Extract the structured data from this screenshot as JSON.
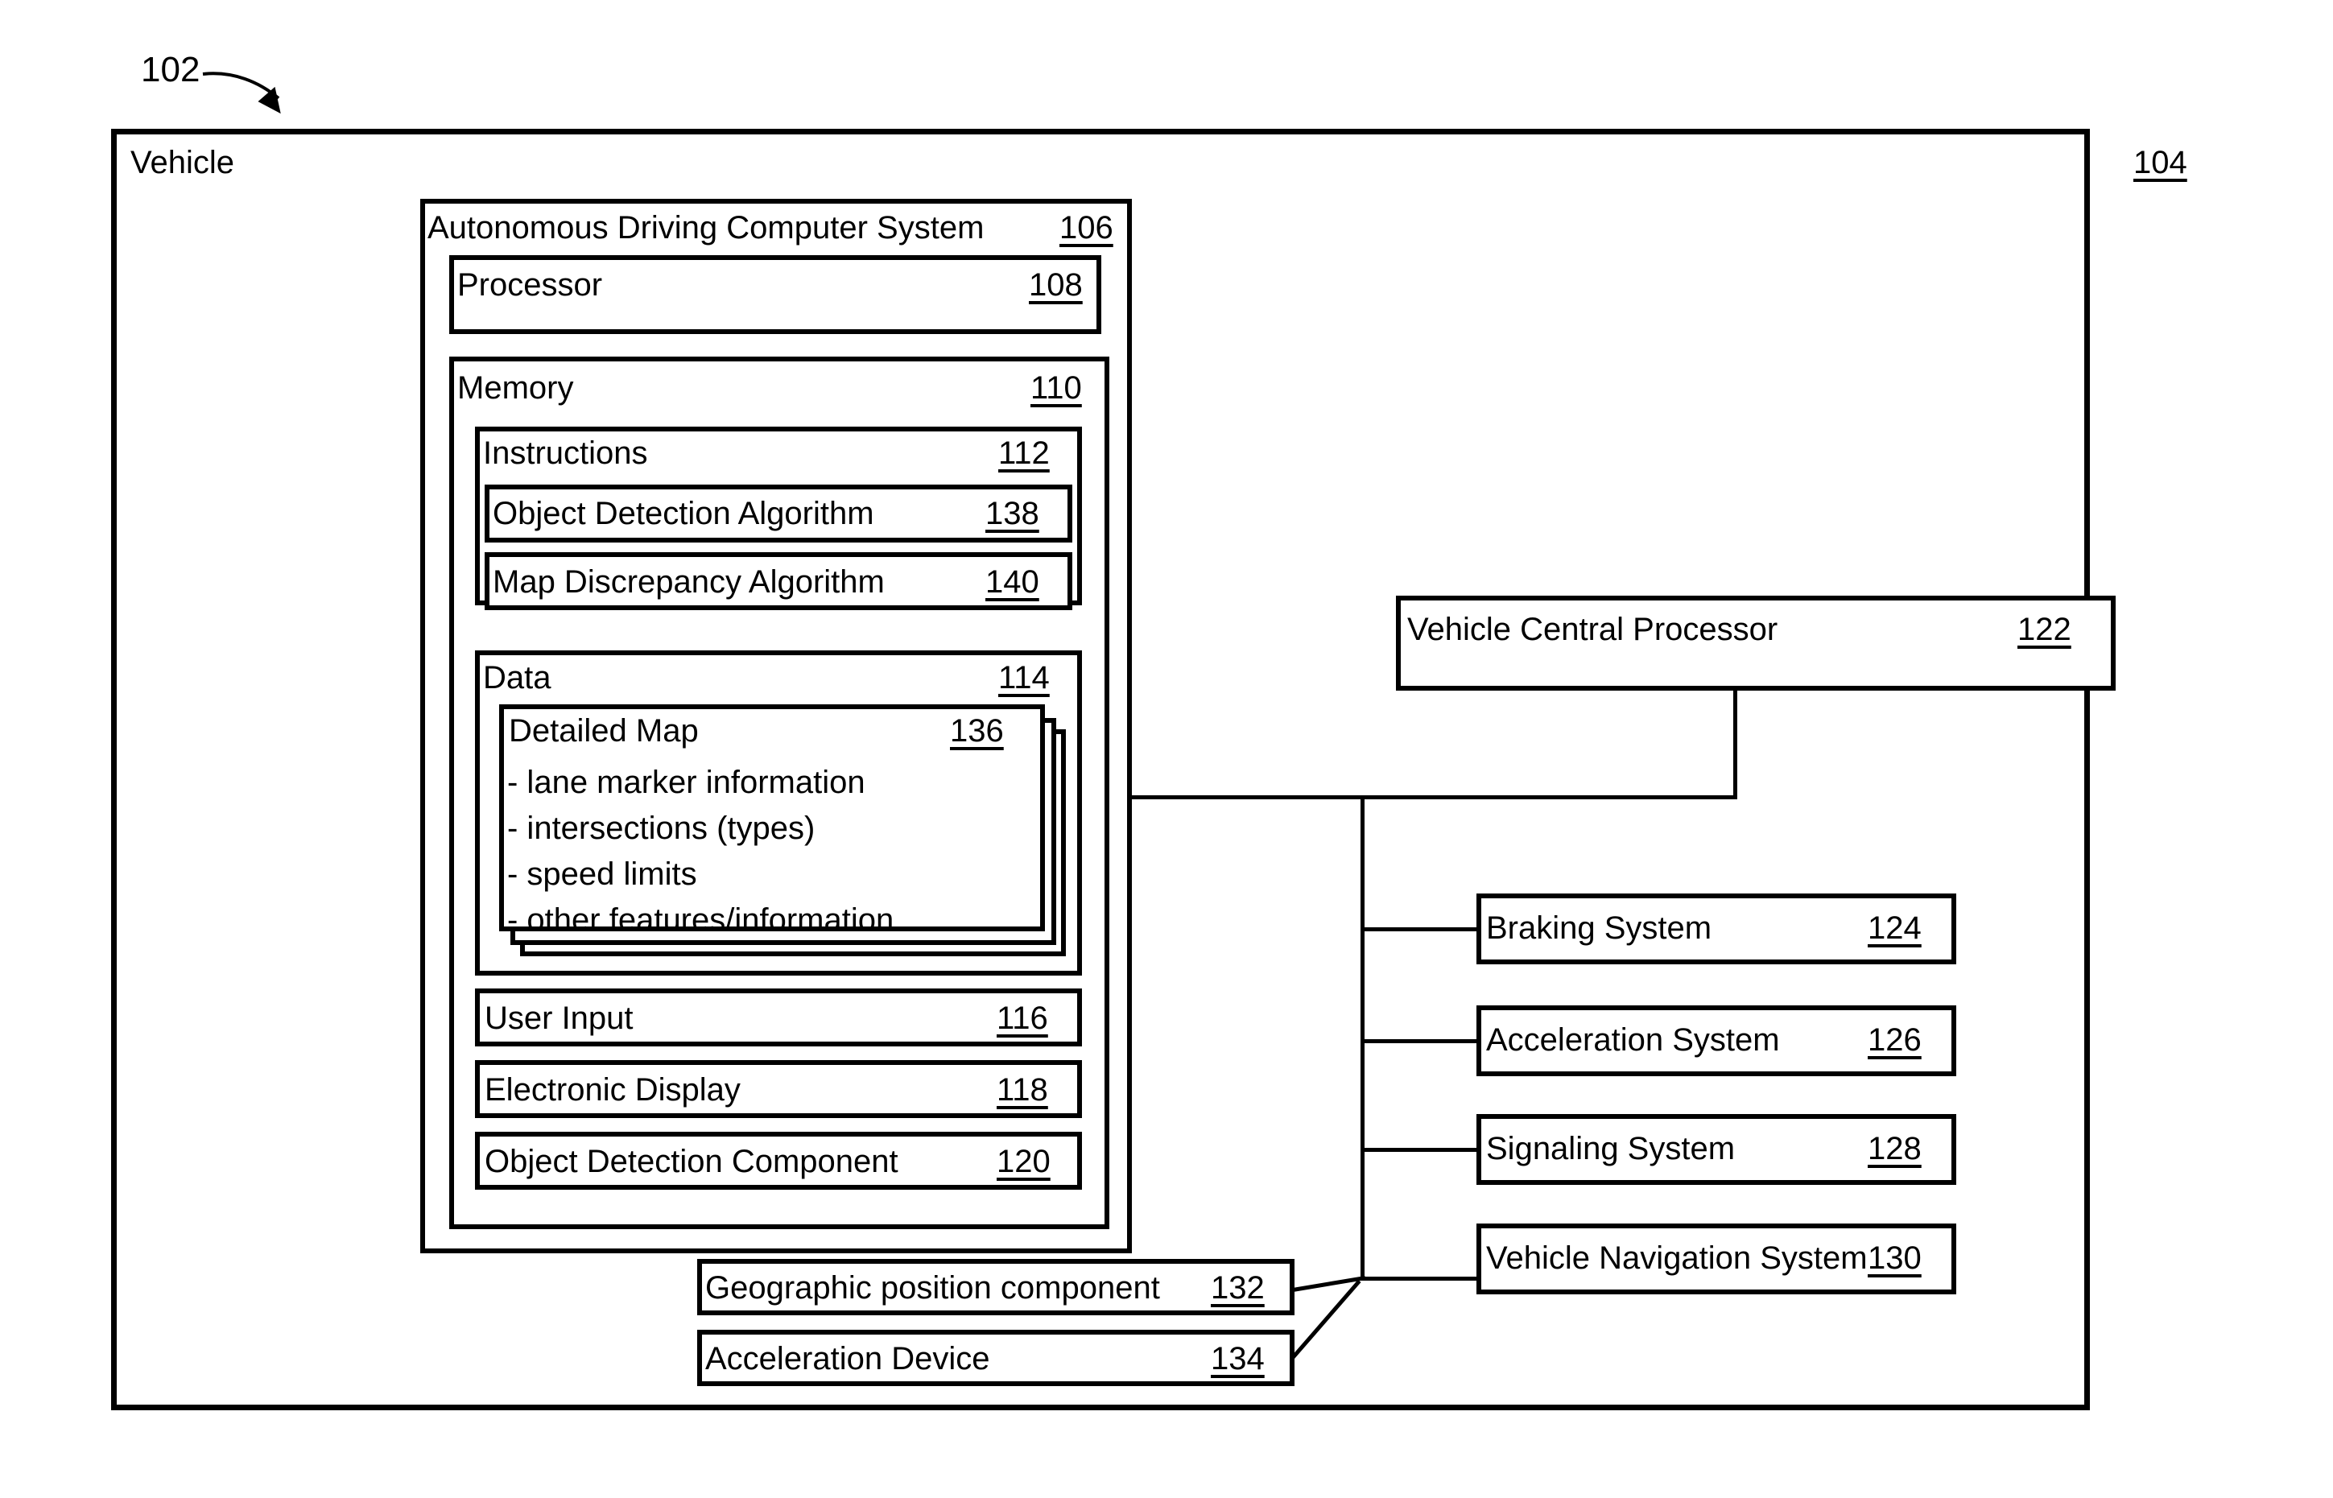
{
  "figure": {
    "ref_tag": "102",
    "outer": {
      "label": "Vehicle",
      "number": "104"
    },
    "adcs": {
      "label": "Autonomous Driving Computer System",
      "number": "106"
    },
    "processor": {
      "label": "Processor",
      "number": "108"
    },
    "memory": {
      "label": "Memory",
      "number": "110"
    },
    "instructions": {
      "label": "Instructions",
      "number": "112"
    },
    "object_detection_algorithm": {
      "label": "Object Detection Algorithm",
      "number": "138"
    },
    "map_discrepancy_algorithm": {
      "label": "Map Discrepancy Algorithm",
      "number": "140"
    },
    "data": {
      "label": "Data",
      "number": "114"
    },
    "detailed_map": {
      "label": "Detailed Map",
      "number": "136",
      "bullets": [
        "- lane marker information",
        "- intersections (types)",
        "- speed limits",
        "- other features/information"
      ]
    },
    "user_input": {
      "label": "User Input",
      "number": "116"
    },
    "electronic_display": {
      "label": "Electronic Display",
      "number": "118"
    },
    "object_detection_component": {
      "label": "Object Detection Component",
      "number": "120"
    },
    "vehicle_central_processor": {
      "label": "Vehicle Central Processor",
      "number": "122"
    },
    "braking_system": {
      "label": "Braking System",
      "number": "124"
    },
    "acceleration_system": {
      "label": "Acceleration System",
      "number": "126"
    },
    "signaling_system": {
      "label": "Signaling System",
      "number": "128"
    },
    "vehicle_navigation_system": {
      "label": "Vehicle Navigation System",
      "number": "130"
    },
    "geographic_position_component": {
      "label": "Geographic position component",
      "number": "132"
    },
    "acceleration_device": {
      "label": "Acceleration Device",
      "number": "134"
    }
  },
  "colors": {
    "stroke": "#000000",
    "background": "#ffffff"
  }
}
